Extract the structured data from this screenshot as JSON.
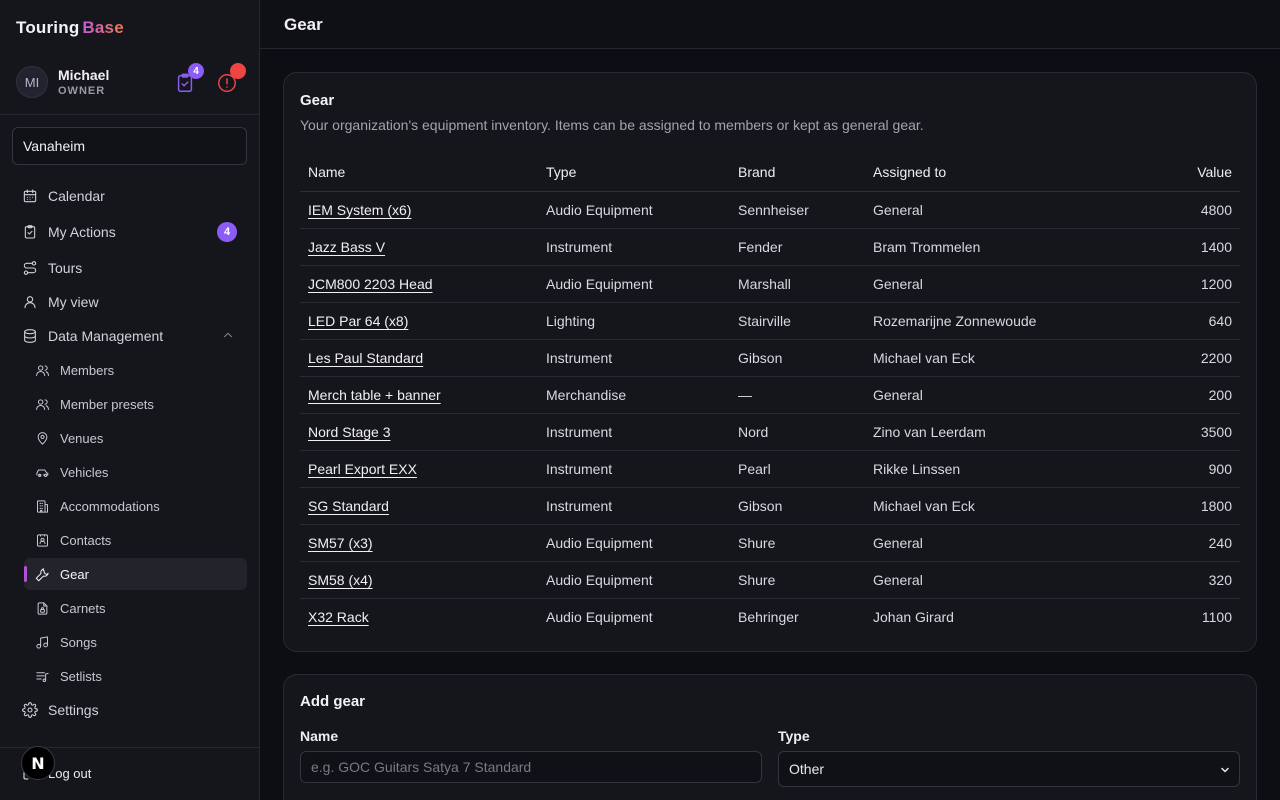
{
  "brand": {
    "first": "Touring",
    "second": "Base"
  },
  "user": {
    "initials": "MI",
    "name": "Michael",
    "role": "OWNER",
    "tasks_badge": "4"
  },
  "org_selector": {
    "value": "Vanaheim"
  },
  "nav": {
    "calendar": "Calendar",
    "my_actions": "My Actions",
    "my_actions_badge": "4",
    "tours": "Tours",
    "my_view": "My view",
    "data_management": "Data Management",
    "sub": {
      "members": "Members",
      "member_presets": "Member presets",
      "venues": "Venues",
      "vehicles": "Vehicles",
      "accommodations": "Accommodations",
      "contacts": "Contacts",
      "gear": "Gear",
      "carnets": "Carnets",
      "songs": "Songs",
      "setlists": "Setlists"
    },
    "settings": "Settings",
    "logout": "Log out"
  },
  "page": {
    "title": "Gear"
  },
  "gear_card": {
    "title": "Gear",
    "description": "Your organization's equipment inventory. Items can be assigned to members or kept as general gear.",
    "columns": {
      "name": "Name",
      "type": "Type",
      "brand": "Brand",
      "assigned": "Assigned to",
      "value": "Value"
    },
    "rows": [
      {
        "name": "IEM System (x6)",
        "type": "Audio Equipment",
        "brand": "Sennheiser",
        "assigned": "General",
        "value": "4800"
      },
      {
        "name": "Jazz Bass V",
        "type": "Instrument",
        "brand": "Fender",
        "assigned": "Bram Trommelen",
        "value": "1400"
      },
      {
        "name": "JCM800 2203 Head",
        "type": "Audio Equipment",
        "brand": "Marshall",
        "assigned": "General",
        "value": "1200"
      },
      {
        "name": "LED Par 64 (x8)",
        "type": "Lighting",
        "brand": "Stairville",
        "assigned": "Rozemarijne Zonnewoude",
        "value": "640"
      },
      {
        "name": "Les Paul Standard",
        "type": "Instrument",
        "brand": "Gibson",
        "assigned": "Michael van Eck",
        "value": "2200"
      },
      {
        "name": "Merch table + banner",
        "type": "Merchandise",
        "brand": "—",
        "assigned": "General",
        "value": "200"
      },
      {
        "name": "Nord Stage 3",
        "type": "Instrument",
        "brand": "Nord",
        "assigned": "Zino van Leerdam",
        "value": "3500"
      },
      {
        "name": "Pearl Export EXX",
        "type": "Instrument",
        "brand": "Pearl",
        "assigned": "Rikke Linssen",
        "value": "900"
      },
      {
        "name": "SG Standard",
        "type": "Instrument",
        "brand": "Gibson",
        "assigned": "Michael van Eck",
        "value": "1800"
      },
      {
        "name": "SM57 (x3)",
        "type": "Audio Equipment",
        "brand": "Shure",
        "assigned": "General",
        "value": "240"
      },
      {
        "name": "SM58 (x4)",
        "type": "Audio Equipment",
        "brand": "Shure",
        "assigned": "General",
        "value": "320"
      },
      {
        "name": "X32 Rack",
        "type": "Audio Equipment",
        "brand": "Behringer",
        "assigned": "Johan Girard",
        "value": "1100"
      }
    ]
  },
  "add_card": {
    "title": "Add gear",
    "name_label": "Name",
    "name_placeholder": "e.g. GOC Guitars Satya 7 Standard",
    "type_label": "Type",
    "type_value": "Other"
  },
  "dev_badge": "N",
  "colors": {
    "accent": "#8b5cf6",
    "alert": "#ef4444",
    "active_marker": "#b150d8"
  }
}
